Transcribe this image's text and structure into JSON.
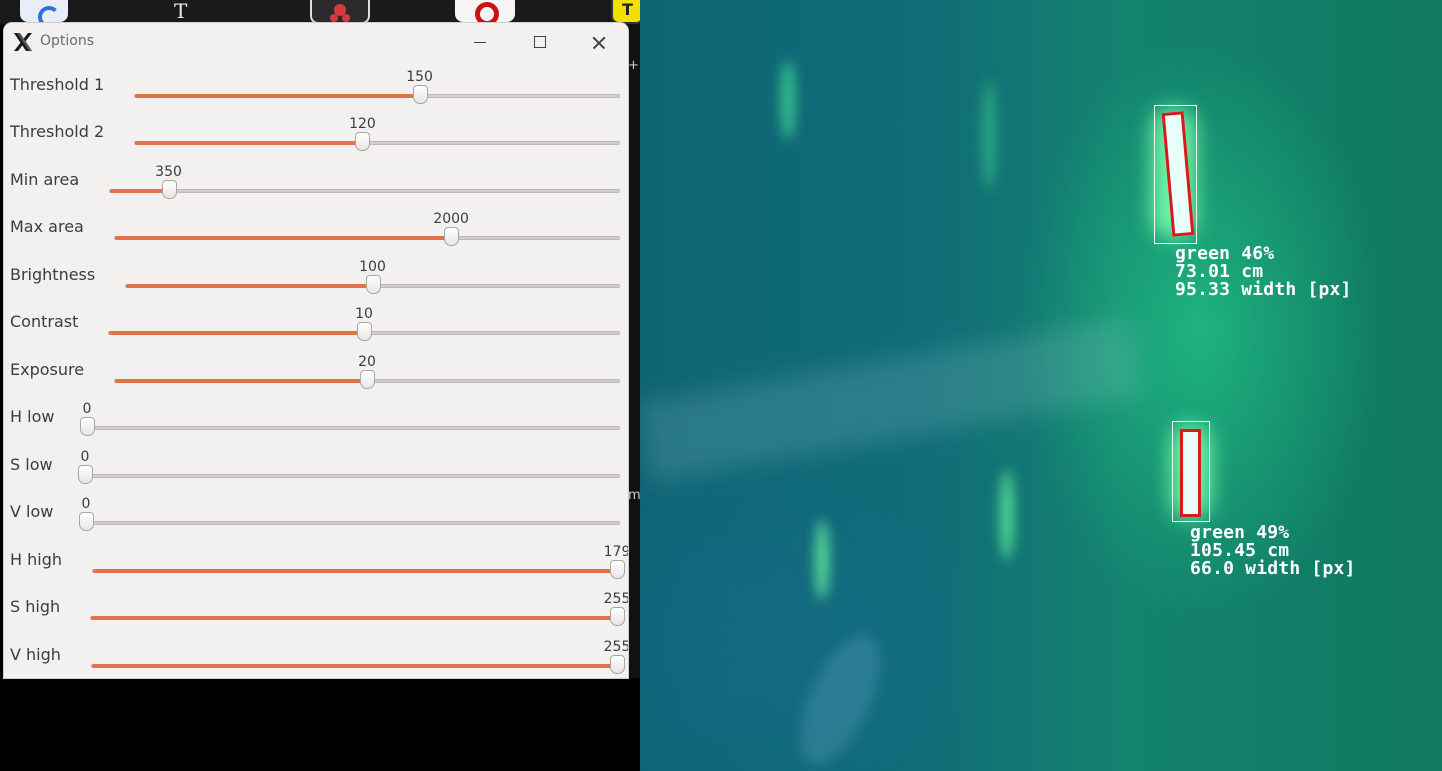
{
  "desktop": {
    "icon_text_2": "T",
    "icon_text_5": "T",
    "side_glyph_plus": "+",
    "side_glyph_m": "m"
  },
  "window": {
    "title": "Options",
    "controls": [
      "minimize",
      "maximize",
      "close"
    ]
  },
  "sliders": [
    {
      "label": "Threshold 1",
      "value": "150",
      "fraction": 0.588
    },
    {
      "label": "Threshold 2",
      "value": "120",
      "fraction": 0.47
    },
    {
      "label": "Min area",
      "value": "350",
      "fraction": 0.115
    },
    {
      "label": "Max area",
      "value": "2000",
      "fraction": 0.667
    },
    {
      "label": "Brightness",
      "value": "100",
      "fraction": 0.5
    },
    {
      "label": "Contrast",
      "value": "10",
      "fraction": 0.5
    },
    {
      "label": "Exposure",
      "value": "20",
      "fraction": 0.5
    },
    {
      "label": "H low",
      "value": "0",
      "fraction": 0
    },
    {
      "label": "S low",
      "value": "0",
      "fraction": 0
    },
    {
      "label": "V low",
      "value": "0",
      "fraction": 0
    },
    {
      "label": "H high",
      "value": "179",
      "fraction": 1
    },
    {
      "label": "S high",
      "value": "255",
      "fraction": 1
    },
    {
      "label": "V high",
      "value": "255",
      "fraction": 1
    }
  ],
  "colors": {
    "slider_fill": "#e0734a",
    "detection_rect": "#d81a1a",
    "window_bg": "#f2f1f0"
  },
  "detections": [
    {
      "lines": [
        "green 46%",
        "73.01 cm",
        "95.33 width [px]"
      ]
    },
    {
      "lines": [
        "green 49%",
        "105.45 cm",
        "66.0 width [px]"
      ]
    }
  ]
}
